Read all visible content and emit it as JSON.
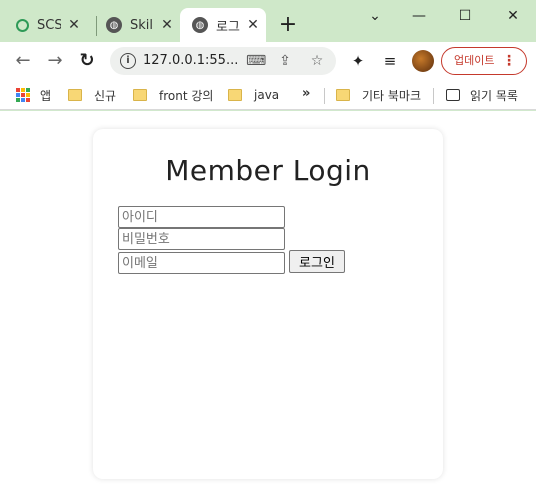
{
  "browser": {
    "tabs": [
      {
        "title": "SCS",
        "favicon": "green-circle-icon"
      },
      {
        "title": "Skill",
        "favicon": "globe-icon"
      },
      {
        "title": "로그",
        "favicon": "globe-icon",
        "active": true
      }
    ],
    "new_tab_label": "+",
    "window_controls": {
      "minimize": "—",
      "maximize": "☐",
      "close": "✕",
      "tab_search": "⌄"
    },
    "address": {
      "url": "127.0.0.1:55..."
    },
    "update_button_label": "업데이트"
  },
  "bookmarks": {
    "items": [
      {
        "label": "앱",
        "icon": "apps-grid-icon"
      },
      {
        "label": "신규",
        "icon": "folder-icon"
      },
      {
        "label": "front 강의",
        "icon": "folder-icon"
      },
      {
        "label": "java",
        "icon": "folder-icon"
      }
    ],
    "overflow": "»",
    "other_bookmarks": "기타 북마크",
    "reading_list": "읽기 목록"
  },
  "page": {
    "title": "Member Login",
    "fields": {
      "id_placeholder": "아이디",
      "password_placeholder": "비밀번호",
      "email_placeholder": "이메일"
    },
    "login_button": "로그인"
  },
  "colors": {
    "titlebar": "#cfe8c9",
    "update_accent": "#c5392c"
  }
}
